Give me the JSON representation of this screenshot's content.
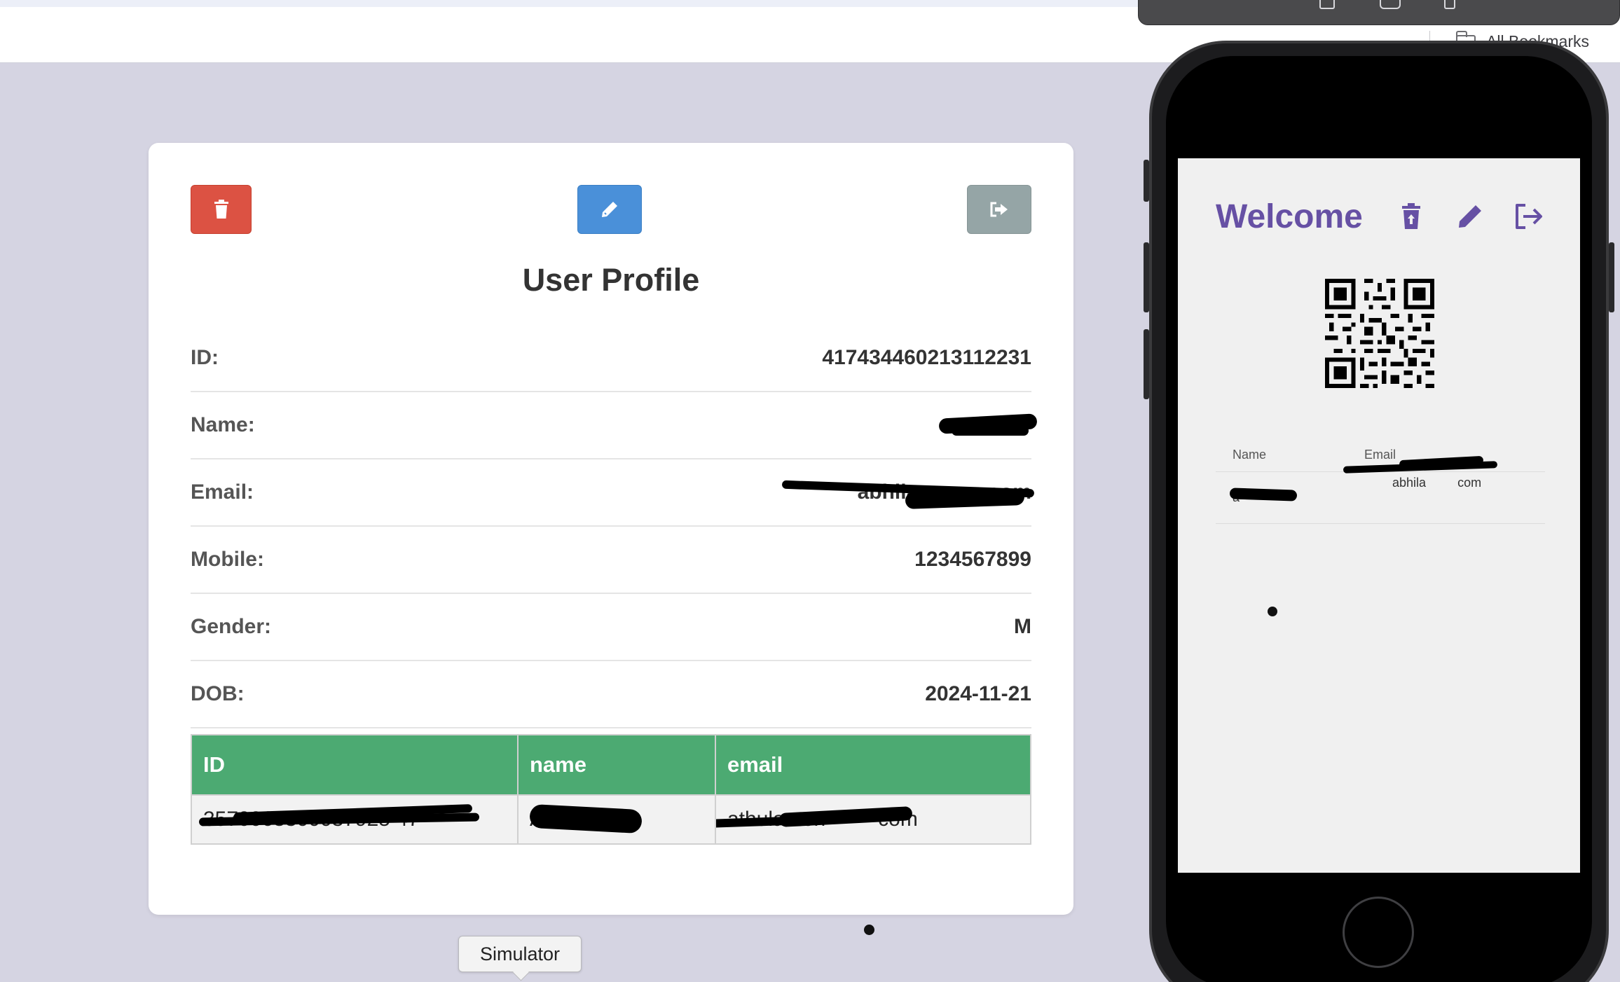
{
  "bookmarks": {
    "label": "All Bookmarks"
  },
  "profile": {
    "title": "User Profile",
    "fields": [
      {
        "label": "ID:",
        "value": "417434460213112231"
      },
      {
        "label": "Name:",
        "value": "a"
      },
      {
        "label": "Email:",
        "value": "abhila            com"
      },
      {
        "label": "Mobile:",
        "value": "1234567899"
      },
      {
        "label": "Gender:",
        "value": "M"
      },
      {
        "label": "DOB:",
        "value": "2024-11-21"
      }
    ],
    "table": {
      "headers": [
        "ID",
        "name",
        "email"
      ],
      "rows": [
        [
          "3570068300037925 47",
          "A",
          "athulanton         com"
        ]
      ]
    }
  },
  "tooltip": {
    "text": "Simulator"
  },
  "app": {
    "title": "Welcome",
    "table": {
      "headers": [
        "Name",
        "Email"
      ],
      "rows": [
        [
          "a",
          "abhila         com"
        ]
      ]
    }
  },
  "colors": {
    "delete": "#dc5243",
    "edit": "#4a90d9",
    "logout": "#95a5a6",
    "table_header": "#4caa72",
    "app_accent": "#6650a4"
  },
  "icons": {
    "delete": "trash-icon",
    "edit": "pencil-icon",
    "logout": "sign-out-icon"
  }
}
